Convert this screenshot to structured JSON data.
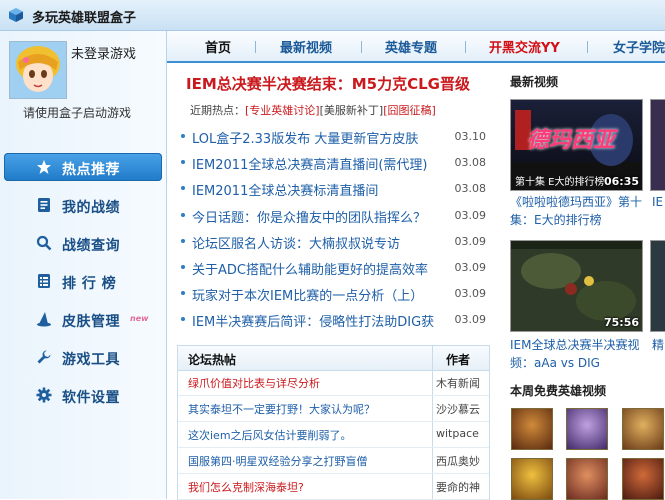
{
  "window": {
    "title": "多玩英雄联盟盒子"
  },
  "sidebar": {
    "login_status": "未登录游戏",
    "login_hint": "请使用盒子启动游戏",
    "items": [
      {
        "label": "热点推荐",
        "icon": "star-icon",
        "active": true
      },
      {
        "label": "我的战绩",
        "icon": "record-icon"
      },
      {
        "label": "战绩查询",
        "icon": "search-icon"
      },
      {
        "label": "排 行 榜",
        "icon": "list-icon"
      },
      {
        "label": "皮肤管理",
        "icon": "wizard-hat-icon",
        "badge": "new"
      },
      {
        "label": "游戏工具",
        "icon": "wrench-icon"
      },
      {
        "label": "软件设置",
        "icon": "gear-icon"
      }
    ]
  },
  "tabs": [
    {
      "label": "首页"
    },
    {
      "label": "最新视频"
    },
    {
      "label": "英雄专题"
    },
    {
      "label": "开黑交流YY"
    },
    {
      "label": "女子学院"
    }
  ],
  "headline": "IEM总决赛半决赛结束：M5力克CLG晋级",
  "hot": {
    "label": "近期热点：",
    "tags": [
      "[专业英雄讨论]",
      "[美服新补丁]",
      "[囧图征稿]"
    ]
  },
  "news": [
    {
      "title": "LOL盒子2.33版发布 大量更新官方皮肤",
      "date": "03.10"
    },
    {
      "title": "IEM2011全球总决赛高清直播间(需代理)",
      "date": "03.08"
    },
    {
      "title": "IEM2011全球总决赛标清直播间",
      "date": "03.08"
    },
    {
      "title": "今日话题：你是众撸友中的团队指挥么？",
      "date": "03.09"
    },
    {
      "title": "论坛区服名人访谈：大楠叔叔说专访",
      "date": "03.09"
    },
    {
      "title": "关于ADC搭配什么辅助能更好的提高效率",
      "date": "03.09"
    },
    {
      "title": "玩家对于本次IEM比赛的一点分析（上）",
      "date": "03.09"
    },
    {
      "title": "IEM半决赛赛后简评：侵略性打法助DIG获",
      "date": "03.09"
    }
  ],
  "forum": {
    "header_title": "论坛热帖",
    "header_author": "作者",
    "rows": [
      {
        "title": "绿爪价值对比表与详尽分析",
        "author": "木有新闻",
        "red": true
      },
      {
        "title": "其实泰坦不一定要打野！大家认为呢？",
        "author": "沙沙慕云"
      },
      {
        "title": "这次iem之后风女估计要削弱了。",
        "author": "witpace"
      },
      {
        "title": "国服第四·明星双经验分享之打野盲僧",
        "author": "西瓜奥妙"
      },
      {
        "title": "我们怎么克制深海泰坦?",
        "author": "要命的神",
        "red": true
      }
    ]
  },
  "latest_videos": {
    "title": "最新视频",
    "videos": [
      {
        "caption": "《啦啦啦德玛西亚》第十集：E大的排行榜",
        "duration": "06:35",
        "thumb_text": "德玛西亚",
        "thumb_sub": "第十集 E大的排行榜"
      },
      {
        "caption": "IEM全球总决赛半决赛视频：aAa vs DIG",
        "duration": "75:56"
      }
    ],
    "partial_captions": [
      "IE",
      "精"
    ]
  },
  "free_heroes": {
    "title": "本周免费英雄视频"
  },
  "colors": {
    "accent": "#1f7ac8",
    "headline_red": "#c9191d",
    "link_blue": "#1e5fa8"
  }
}
